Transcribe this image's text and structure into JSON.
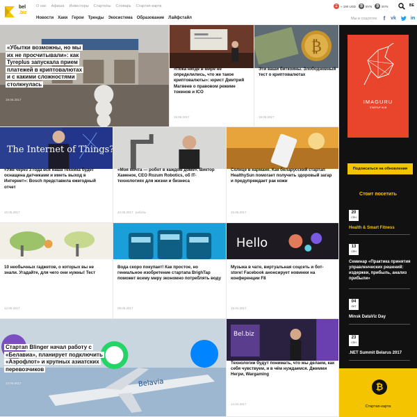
{
  "logo": {
    "line1": "bel",
    "line2": ".biz"
  },
  "top_links": [
    "О нас",
    "Афиша",
    "Инвесторы",
    "Стартапы",
    "Словарь",
    "Стартап-карта"
  ],
  "main_nav": [
    "Новости",
    "Хаки",
    "Герои",
    "Тренды",
    "Экосистема",
    "Образование",
    "Лайфстайл"
  ],
  "rates": [
    {
      "code": "ETH",
      "value": "≈ 190 USD",
      "color": "#e84c3d"
    },
    {
      "code": "BYN",
      "value": "BYN",
      "color": "#555555"
    },
    {
      "code": "BYN2",
      "value": "BYN",
      "color": "#555555"
    }
  ],
  "lang": "BE",
  "social_label": "Мы в соцсетях",
  "social": [
    "f",
    "vk",
    "tw",
    "in"
  ],
  "tiles": [
    {
      "title": "«Убытки возможны, но мы их не просчитывали»: как Tyreplus запускала прием платежей в криптовалютах и с какими сложностями столкнулась",
      "date": "19.05.2017"
    },
    {
      "title": "«Пока нигде в мире не определились, что же такое криптовалюты»: юрист Дмитрий Матвеев о правовом режиме токенов и ICO",
      "date": "19.05.2017"
    },
    {
      "title": "Эти ваши биткоины. Злободневный тест о криптовалютах",
      "date": "18.05.2017"
    },
    {
      "title": "«Уже через 3 года вся наша техника будет оснащена датчиками и иметь выход в Интернет»: Bosch представила ежегодный отчет",
      "date": "19.05.2017"
    },
    {
      "title": "«Моя мечта — робот в каждом доме». Виктор Хаменок, CEO Rozum Robotics, об IT-технологиях для жизни и бизнеса",
      "date": "22.05.2017",
      "tag": "роботы"
    },
    {
      "title": "Солнце в кармане. Как беларусский стартап HealthySun помогает получить здоровый загар и предупреждает рак кожи",
      "date": "15.05.2017"
    },
    {
      "title": "10 необычных гаджетов, о которых вы не знали. Угадайте, для чего они нужны! Тест",
      "date": "12.05.2017"
    },
    {
      "title": "Вода скоро покупает! Как простое, но гениальное изобретение стартапа BrighTap поможет всему миру экономно потреблять воду",
      "date": "09.05.2017"
    },
    {
      "title": "Музыка в чате, виртуальная соцсеть и бот-store! Facebook анонсирует новинки на конференции F8",
      "date": "19.04.2017"
    },
    {
      "title": "Стартап Blinger начал работу с «Белавиа», планирует подключить «Аэрофлот» и крупных азиатских перевозчиков",
      "date": "13.05.2017"
    },
    {
      "title": "Технологии будут понимать, что мы делаем, как себя чувствуем, и в чём нуждаемся. Джемми Негри, Wargaming",
      "date": "14.04.2017"
    }
  ],
  "image_text": {
    "iot": "The Internet of Things?",
    "hello": "Hello",
    "belbiz": "Bel.biz",
    "belavia": "Belavia"
  },
  "sidebar": {
    "ad_brand": "IMAGURU",
    "ad_sub": "STARTUP HUB",
    "subscribe": "Подписаться на обновления",
    "events_title": "Стоит посетить",
    "events": [
      {
        "day": "20",
        "month": "СЕН",
        "title": "Health & Smart Fitness",
        "color": "#f5c400"
      },
      {
        "day": "13",
        "month": "СЕН",
        "title": "Семинар «Практика принятия управленческих решений: издержки, прибыль, анализ прибыли»",
        "color": "#ffffff"
      },
      {
        "day": "04",
        "month": "ОКТ",
        "title": "Minsk DataViz Day",
        "color": "#ffffff"
      },
      {
        "day": "23",
        "month": "СЕН",
        "title": ".NET Summit Belarus 2017",
        "color": "#ffffff"
      }
    ],
    "crypto_map": "Стартап-карта"
  }
}
